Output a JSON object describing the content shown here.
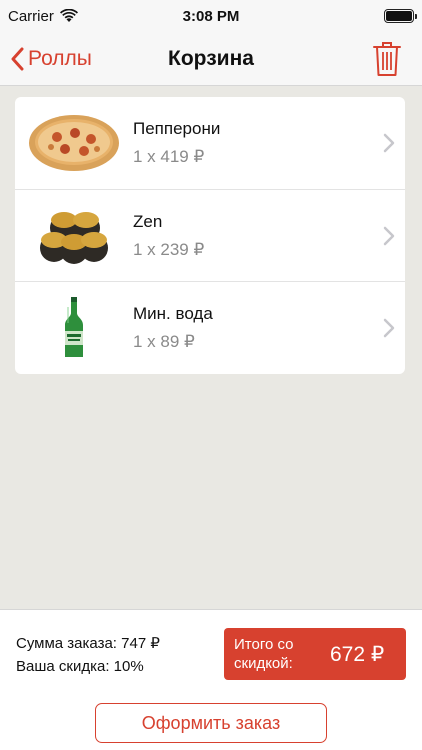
{
  "status_bar": {
    "carrier": "Carrier",
    "time": "3:08 PM"
  },
  "nav": {
    "back_label": "Роллы",
    "title": "Корзина",
    "trash_icon": "trash-icon"
  },
  "cart": {
    "items": [
      {
        "name": "Пепперони",
        "price": "1 x 419 ₽",
        "thumb": "pizza-image"
      },
      {
        "name": "Zen",
        "price": "1 x 239 ₽",
        "thumb": "sushi-rolls-image"
      },
      {
        "name": "Мин. вода",
        "price": "1 x 89 ₽",
        "thumb": "water-bottle-image"
      }
    ]
  },
  "summary": {
    "order_sum": "Сумма заказа: 747 ₽",
    "discount": "Ваша скидка: 10%",
    "total_label": "Итого со скидкой:",
    "total_value": "672 ₽",
    "checkout_label": "Оформить заказ"
  },
  "colors": {
    "accent": "#d7412f",
    "background": "#e9e8e3"
  }
}
